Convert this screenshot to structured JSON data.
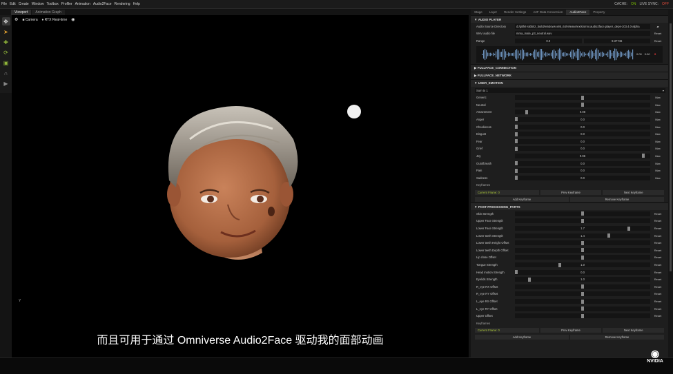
{
  "menubar": {
    "items": [
      "File",
      "Edit",
      "Create",
      "Window",
      "Toolbox",
      "Profiler",
      "Animation",
      "Audio2Face",
      "Rendering",
      "Help"
    ],
    "cache": "CACHE:",
    "cache_status": "ON",
    "live_sync": "LIVE SYNC:",
    "live_status": "OFF"
  },
  "left_tabs": [
    "Viewport",
    "Animation Graph"
  ],
  "viewport": {
    "camera": "Camera",
    "rtx": "RTX Real-time",
    "axis": "Y"
  },
  "subtitle": "而且可用于通过 Omniverse Audio2Face 驱动我的面部动画",
  "right_tabs": [
    "Stage",
    "Layer",
    "Render Settings",
    "A2F Data Conversion",
    "Audio2Face",
    "Property"
  ],
  "audio_player": {
    "title": "AUDIO PLAYER",
    "source_label": "Audio Source Directory",
    "source_value": "d:/git/kit-rabbitz_build/windows-x86_64/release/exts/omni.audio2face.player_deps-103.4.0-alpha",
    "wav_label": "WAV audio file",
    "wav_value": "mma_male_p3_neutral.wav",
    "wav_btn": "Reset",
    "range_label": "Range",
    "range_start": "0.0",
    "range_end": "9.37746",
    "range_btn": "Reset",
    "time_a": "0:00",
    "time_b": "0:00"
  },
  "sections": {
    "connection": "FULLFACE_CONNECTION",
    "network": "FULLFACE_NETWORK",
    "emotion": "USER_EMOTION",
    "post": "POST-PROCESSING_PARTS"
  },
  "emotion": {
    "dropdown": "Sum to 1",
    "max_label": "Max",
    "rows": [
      {
        "name": "Generic",
        "value": "",
        "level": 0.5
      },
      {
        "name": "Neutral",
        "value": "",
        "level": 0.5
      },
      {
        "name": "Amazement",
        "value": "0.08",
        "level": 0.08
      },
      {
        "name": "Anger",
        "value": "0.0",
        "level": 0
      },
      {
        "name": "Cheekiness",
        "value": "0.0",
        "level": 0
      },
      {
        "name": "Disgust",
        "value": "0.0",
        "level": 0
      },
      {
        "name": "Fear",
        "value": "0.0",
        "level": 0
      },
      {
        "name": "Grief",
        "value": "0.0",
        "level": 0
      },
      {
        "name": "Joy",
        "value": "0.96",
        "level": 0.96
      },
      {
        "name": "Outofbreath",
        "value": "0.0",
        "level": 0
      },
      {
        "name": "Pain",
        "value": "0.0",
        "level": 0
      },
      {
        "name": "Sadness",
        "value": "0.0",
        "level": 0
      }
    ],
    "keyframes_label": "Keyframes",
    "current_frame": "Current Frame: 0",
    "prev": "Prev Keyframe",
    "next": "Next Keyframe",
    "add": "Add Keyframe",
    "remove": "Remove Keyframe"
  },
  "post": {
    "reset_label": "Reset",
    "rows": [
      {
        "name": "Skin Strength",
        "value": "",
        "level": 0.5
      },
      {
        "name": "Upper Face Strength",
        "value": "",
        "level": 0.5
      },
      {
        "name": "Lower Face Strength",
        "value": "1.7",
        "level": 0.85
      },
      {
        "name": "Lower teeth Strength",
        "value": "1.4",
        "level": 0.7
      },
      {
        "name": "Lower teeth Height Offset",
        "value": "",
        "level": 0.5
      },
      {
        "name": "Lower teeth Depth Offset",
        "value": "",
        "level": 0.5
      },
      {
        "name": "Lip close Offset",
        "value": "",
        "level": 0.5
      },
      {
        "name": "Tongue Strength",
        "value": "1.0",
        "level": 0.33
      },
      {
        "name": "Head motion Strength",
        "value": "0.0",
        "level": 0
      },
      {
        "name": "Eyelids Strength",
        "value": "1.0",
        "level": 0.1
      },
      {
        "name": "R_eye RX Offset",
        "value": "",
        "level": 0.5
      },
      {
        "name": "R_eye RY Offset",
        "value": "",
        "level": 0.5
      },
      {
        "name": "L_eye RX Offset",
        "value": "",
        "level": 0.5
      },
      {
        "name": "L_eye RY Offset",
        "value": "",
        "level": 0.5
      },
      {
        "name": "Upper Offset",
        "value": "",
        "level": 0.5
      }
    ],
    "keyframes_label": "Keyframes",
    "current_frame": "Current Frame: 0",
    "prev": "Prev Keyframe",
    "next": "Next Keyframe",
    "add": "Add Keyframe",
    "remove": "Remove Keyframe"
  },
  "logo": "NVIDIA"
}
